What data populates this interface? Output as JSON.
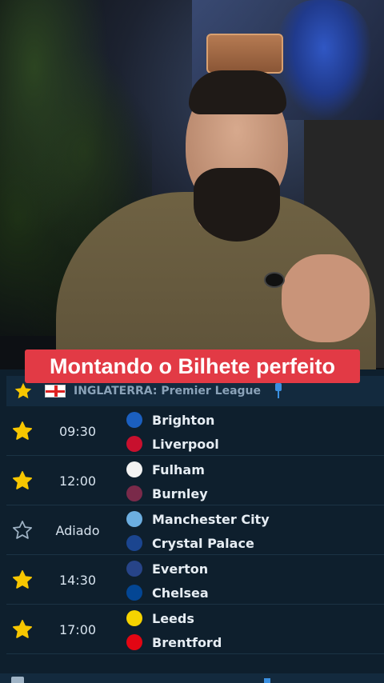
{
  "caption": {
    "text": "Montando o Bilhete perfeito",
    "bg_color": "#e23a45"
  },
  "league": {
    "country": "INGLATERRA",
    "competition": "Premier League",
    "separator": ": ",
    "favorite": true,
    "pinned": true
  },
  "matches": [
    {
      "time": "09:30",
      "favorite": true,
      "home": {
        "name": "Brighton",
        "crest_color": "#1b5fbf",
        "icon": "brighton-crest-icon"
      },
      "away": {
        "name": "Liverpool",
        "crest_color": "#c8102e",
        "icon": "liverpool-crest-icon"
      }
    },
    {
      "time": "12:00",
      "favorite": true,
      "home": {
        "name": "Fulham",
        "crest_color": "#f2f2f2",
        "icon": "fulham-crest-icon"
      },
      "away": {
        "name": "Burnley",
        "crest_color": "#7a2a4a",
        "icon": "burnley-crest-icon"
      }
    },
    {
      "time": "Adiado",
      "favorite": false,
      "home": {
        "name": "Manchester City",
        "crest_color": "#6caee0",
        "icon": "manchester-city-crest-icon"
      },
      "away": {
        "name": "Crystal Palace",
        "crest_color": "#1b458f",
        "icon": "crystal-palace-crest-icon"
      }
    },
    {
      "time": "14:30",
      "favorite": true,
      "home": {
        "name": "Everton",
        "crest_color": "#274488",
        "icon": "everton-crest-icon"
      },
      "away": {
        "name": "Chelsea",
        "crest_color": "#034694",
        "icon": "chelsea-crest-icon"
      }
    },
    {
      "time": "17:00",
      "favorite": true,
      "home": {
        "name": "Leeds",
        "crest_color": "#f5d300",
        "icon": "leeds-crest-icon"
      },
      "away": {
        "name": "Brentford",
        "crest_color": "#e30613",
        "icon": "brentford-crest-icon"
      }
    }
  ],
  "colors": {
    "star_active": "#f7c600",
    "star_inactive": "#9fb3c5",
    "panel_bg": "#0e1f2d",
    "header_bg": "#132a3e"
  }
}
